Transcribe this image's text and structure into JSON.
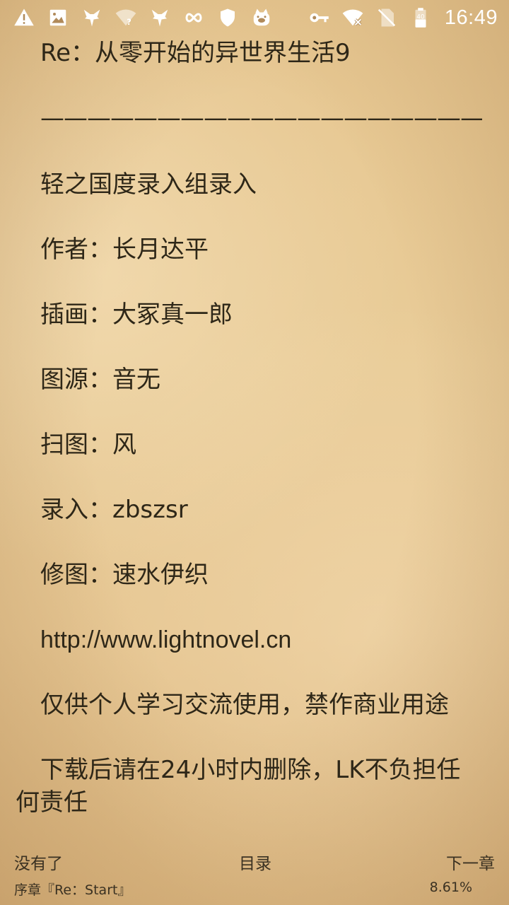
{
  "status_bar": {
    "time": "16:49",
    "battery_level": "40",
    "icons": [
      "alert-icon",
      "image-icon",
      "app-fox-icon",
      "wifi-question-icon",
      "app-fox-icon",
      "infinity-icon",
      "shield-icon",
      "app-pig-icon",
      "key-icon",
      "wifi-x-icon",
      "no-sim-icon",
      "battery-icon"
    ]
  },
  "content": {
    "title": "Re：从零开始的异世界生活9",
    "rule": "——————————————————————",
    "group": "轻之国度录入组录入",
    "author": "作者：长月达平",
    "illustrator": "插画：大冢真一郎",
    "image_source": "图源：音无",
    "scan": "扫图：风",
    "input": "录入：zbszsr",
    "retouch": "修图：速水伊织",
    "url": "http://www.lightnovel.cn",
    "note1": "仅供个人学习交流使用，禁作商业用途",
    "note2": "下载后请在24小时内删除，LK不负担任何责任"
  },
  "nav": {
    "prev_label": "没有了",
    "toc_label": "目录",
    "next_label": "下一章"
  },
  "footer": {
    "chapter_name": "序章『Re：Start』",
    "progress": "8.61%"
  },
  "colors": {
    "paper": "#e8ca96",
    "text": "#2e2718",
    "status_icons": "#ffffff"
  }
}
